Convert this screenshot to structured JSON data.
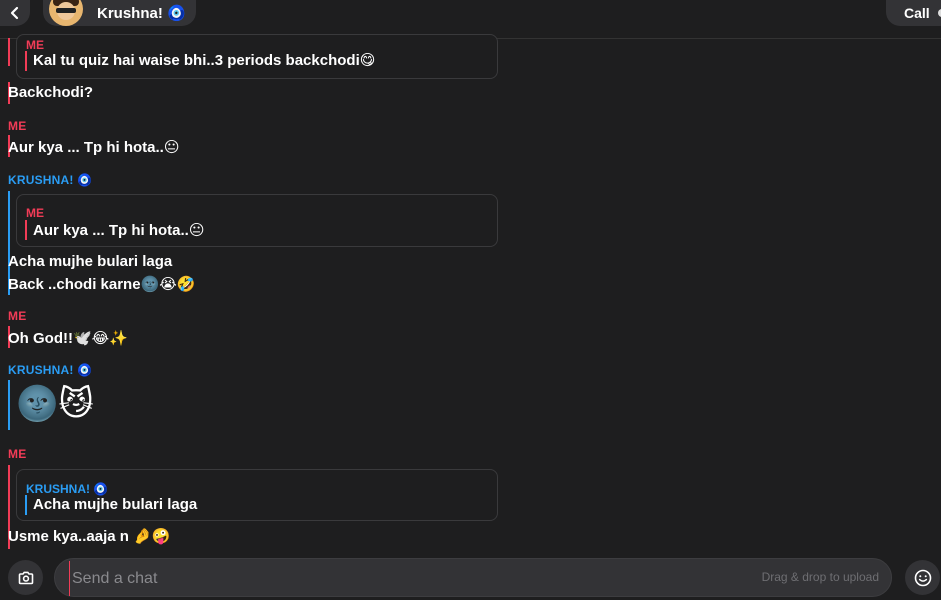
{
  "header": {
    "contact_name": "Krushna! 🧿",
    "call_label": "Call"
  },
  "messages": {
    "g1_quote_sender": "ME",
    "g1_quote_text": "Kal tu quiz hai waise bhi..3 periods backchodi😋",
    "g1_line1": "Backchodi?",
    "g2_sender": "ME",
    "g2_line1": "Aur kya ... Tp hi hota..😐",
    "g3_sender": "KRUSHNA! 🧿",
    "g3_quote_sender": "ME",
    "g3_quote_text": "Aur kya ... Tp hi hota..😐",
    "g3_line1": "Acha mujhe bulari laga",
    "g3_line2": "Back ..chodi karne🌚😭🤣",
    "g4_sender": "ME",
    "g4_line1": "Oh God!!🕊️😂✨",
    "g5_sender": "KRUSHNA! 🧿",
    "g5_emoji": "🌚😼",
    "g6_sender": "ME",
    "g6_quote_sender": "KRUSHNA! 🧿",
    "g6_quote_text": "Acha mujhe bulari laga",
    "g6_line1": "Usme kya..aaja n 🤌🤪"
  },
  "composer": {
    "placeholder": "Send a chat",
    "drag_hint": "Drag & drop to upload"
  },
  "icons": {
    "back": "chevron-left-icon",
    "camera": "camera-icon",
    "emoji": "smiley-icon"
  },
  "colors": {
    "me": "#f23c57",
    "friend": "#2a9df4",
    "background": "#1e1e1f",
    "surface": "#333336"
  }
}
